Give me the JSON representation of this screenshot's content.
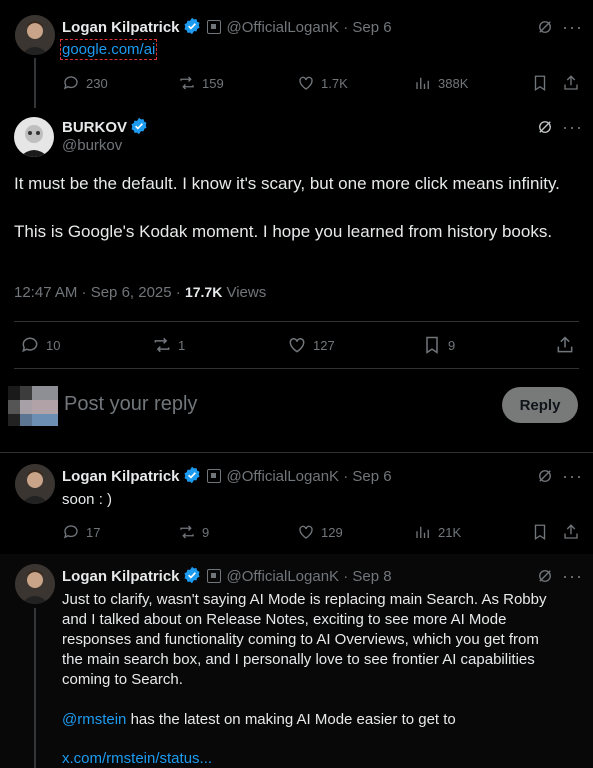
{
  "tweet1": {
    "name": "Logan Kilpatrick",
    "handle": "@OfficialLoganK",
    "date": "Sep 6",
    "link": "google.com/ai",
    "replies": "230",
    "reposts": "159",
    "likes": "1.7K",
    "views": "388K"
  },
  "main_tweet": {
    "name": "BURKOV",
    "handle": "@burkov",
    "line1": "It must be the default. I know it's scary, but one more click means infinity.",
    "line2": "This is Google's Kodak moment. I hope you learned from history books.",
    "timestamp": "12:47 AM · Sep 6, 2025 · ",
    "views_count": "17.7K",
    "views_label": " Views",
    "replies": "10",
    "reposts": "1",
    "likes": "127",
    "bookmarks": "9"
  },
  "composer": {
    "placeholder": "Post your reply",
    "reply_label": "Reply"
  },
  "tweet3": {
    "name": "Logan Kilpatrick",
    "handle": "@OfficialLoganK",
    "date": "Sep 6",
    "text": "soon : )",
    "replies": "17",
    "reposts": "9",
    "likes": "129",
    "views": "21K"
  },
  "tweet4": {
    "name": "Logan Kilpatrick",
    "handle": "@OfficialLoganK",
    "date": "Sep 8",
    "text": "Just to clarify, wasn't saying AI Mode is replacing main Search. As Robby and I talked about on Release Notes, exciting to see more AI Mode responses and functionality coming to AI Overviews, which you get from the main search box, and I personally love to see frontier AI capabilities coming to Search.",
    "mention": "@rmstein",
    "mention_rest": " has the latest on making AI Mode easier to get to",
    "link": "x.com/rmstein/status..."
  },
  "colors": {
    "background": "#000000",
    "text": "#e7e9ea",
    "muted": "#71767b",
    "link": "#1d9bf0",
    "verified": "#1d9bf0"
  }
}
